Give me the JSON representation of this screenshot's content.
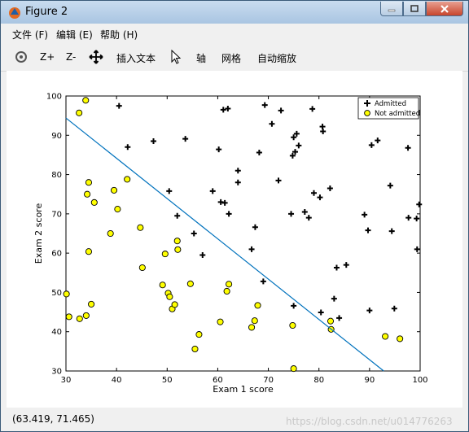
{
  "window": {
    "title": "Figure 2"
  },
  "menu": [
    {
      "label": "文件 (F)"
    },
    {
      "label": "编辑 (E)"
    },
    {
      "label": "帮助 (H)"
    }
  ],
  "toolbar": {
    "zoom_in": "Z+",
    "zoom_out": "Z-",
    "insert_text": "插入文本",
    "axis": "轴",
    "grid": "网格",
    "autoscale": "自动缩放"
  },
  "status": {
    "coords": "(63.419, 71.465)",
    "watermark": "https://blog.csdn.net/u014776263"
  },
  "chart_data": {
    "type": "scatter",
    "xlabel": "Exam 1 score",
    "ylabel": "Exam 2 score",
    "xlim": [
      30,
      100
    ],
    "ylim": [
      30,
      100
    ],
    "xticks": [
      30,
      40,
      50,
      60,
      70,
      80,
      90,
      100
    ],
    "yticks": [
      30,
      40,
      50,
      60,
      70,
      80,
      90,
      100
    ],
    "legend_position": "top-right",
    "series": [
      {
        "name": "Admitted",
        "marker": "+",
        "color": "#000000",
        "points": [
          [
            40.5,
            97.5
          ],
          [
            42.2,
            87.0
          ],
          [
            47.3,
            88.5
          ],
          [
            50.4,
            75.8
          ],
          [
            52.0,
            69.5
          ],
          [
            53.6,
            89.1
          ],
          [
            55.3,
            65.0
          ],
          [
            57.0,
            59.5
          ],
          [
            59.0,
            75.8
          ],
          [
            60.2,
            86.4
          ],
          [
            60.6,
            73.0
          ],
          [
            61.1,
            96.5
          ],
          [
            61.4,
            72.8
          ],
          [
            62.0,
            96.8
          ],
          [
            62.2,
            70.0
          ],
          [
            64.0,
            81.0
          ],
          [
            64.0,
            78.0
          ],
          [
            66.7,
            61.0
          ],
          [
            67.4,
            66.6
          ],
          [
            68.2,
            85.6
          ],
          [
            69.0,
            52.8
          ],
          [
            69.3,
            97.7
          ],
          [
            70.7,
            92.9
          ],
          [
            72.0,
            78.5
          ],
          [
            72.5,
            96.3
          ],
          [
            74.5,
            70.0
          ],
          [
            74.8,
            84.8
          ],
          [
            75.0,
            89.5
          ],
          [
            75.0,
            46.6
          ],
          [
            75.3,
            85.8
          ],
          [
            75.6,
            90.4
          ],
          [
            76.0,
            87.4
          ],
          [
            77.2,
            70.5
          ],
          [
            78.0,
            69.0
          ],
          [
            78.7,
            96.7
          ],
          [
            79.0,
            75.3
          ],
          [
            80.2,
            74.2
          ],
          [
            80.4,
            44.9
          ],
          [
            80.7,
            92.2
          ],
          [
            80.8,
            91.0
          ],
          [
            82.2,
            76.5
          ],
          [
            83.0,
            48.4
          ],
          [
            83.5,
            56.3
          ],
          [
            84.0,
            43.5
          ],
          [
            85.4,
            57.0
          ],
          [
            89.0,
            69.8
          ],
          [
            89.7,
            65.8
          ],
          [
            90.0,
            45.4
          ],
          [
            90.4,
            87.5
          ],
          [
            91.6,
            88.7
          ],
          [
            94.1,
            77.2
          ],
          [
            94.4,
            65.6
          ],
          [
            94.9,
            45.9
          ],
          [
            97.6,
            86.8
          ],
          [
            97.7,
            69.0
          ],
          [
            99.3,
            68.8
          ],
          [
            99.4,
            61.0
          ],
          [
            99.8,
            72.4
          ]
        ]
      },
      {
        "name": "Not admitted",
        "marker": "o",
        "color": "#ffff00",
        "points": [
          [
            30.1,
            49.6
          ],
          [
            30.6,
            43.8
          ],
          [
            32.6,
            95.7
          ],
          [
            32.7,
            43.3
          ],
          [
            33.9,
            98.9
          ],
          [
            34.0,
            44.1
          ],
          [
            34.2,
            75.0
          ],
          [
            34.5,
            60.4
          ],
          [
            34.5,
            78.0
          ],
          [
            35.0,
            47.0
          ],
          [
            35.6,
            72.9
          ],
          [
            38.8,
            65.0
          ],
          [
            39.5,
            76.0
          ],
          [
            40.2,
            71.2
          ],
          [
            42.1,
            78.8
          ],
          [
            44.7,
            66.5
          ],
          [
            45.1,
            56.3
          ],
          [
            49.1,
            51.9
          ],
          [
            49.6,
            59.8
          ],
          [
            50.2,
            49.8
          ],
          [
            50.5,
            48.9
          ],
          [
            51.0,
            45.8
          ],
          [
            51.5,
            46.9
          ],
          [
            52.0,
            63.1
          ],
          [
            52.1,
            60.9
          ],
          [
            54.6,
            52.2
          ],
          [
            55.5,
            35.6
          ],
          [
            56.3,
            39.3
          ],
          [
            60.5,
            42.5
          ],
          [
            61.8,
            50.3
          ],
          [
            62.2,
            52.1
          ],
          [
            66.7,
            41.1
          ],
          [
            67.3,
            42.8
          ],
          [
            67.9,
            46.7
          ],
          [
            74.8,
            41.6
          ],
          [
            75.0,
            30.6
          ],
          [
            82.3,
            42.7
          ],
          [
            82.4,
            40.6
          ],
          [
            93.1,
            38.8
          ],
          [
            96.0,
            38.2
          ]
        ]
      }
    ],
    "decision_boundary": {
      "color": "#0072bd",
      "points": [
        [
          30,
          94.4
        ],
        [
          92.8,
          30
        ]
      ]
    },
    "legend": [
      {
        "label": "Admitted",
        "marker": "+"
      },
      {
        "label": "Not admitted",
        "marker": "o"
      }
    ]
  }
}
